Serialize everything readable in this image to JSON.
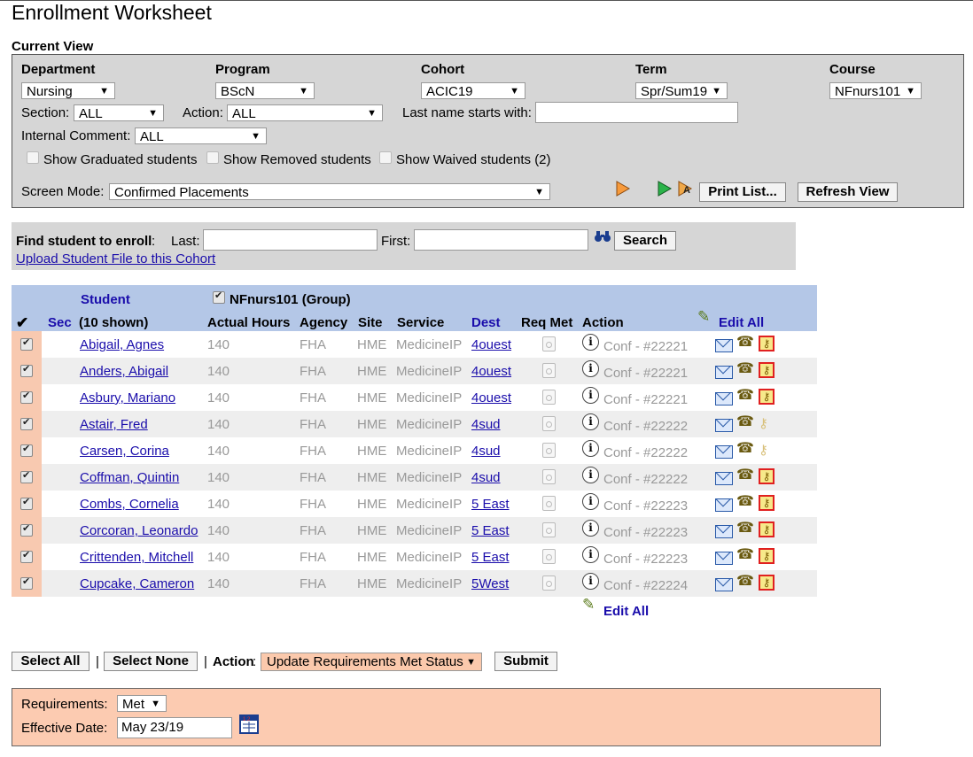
{
  "page_title": "Enrollment Worksheet",
  "current_view": {
    "title": "Current View",
    "department": {
      "label": "Department",
      "value": "Nursing"
    },
    "program": {
      "label": "Program",
      "value": "BScN"
    },
    "cohort": {
      "label": "Cohort",
      "value": "ACIC19"
    },
    "term": {
      "label": "Term",
      "value": "Spr/Sum19"
    },
    "course": {
      "label": "Course",
      "value": "NFnurs101"
    },
    "section": {
      "label": "Section:",
      "value": "ALL"
    },
    "action": {
      "label": "Action:",
      "value": "ALL"
    },
    "last_name": {
      "label": "Last name starts with:",
      "value": ""
    },
    "internal_comment": {
      "label": "Internal Comment:",
      "value": "ALL"
    },
    "show_graduated": {
      "label": "Show Graduated students",
      "checked": false
    },
    "show_removed": {
      "label": "Show Removed students",
      "checked": false
    },
    "show_waived": {
      "label": "Show Waived students (2)",
      "checked": false
    },
    "screen_mode": {
      "label": "Screen Mode:",
      "value": "Confirmed Placements"
    },
    "print_list": "Print List...",
    "refresh_view": "Refresh View"
  },
  "find": {
    "label": "Find student to enroll",
    "last_label": "Last:",
    "first_label": "First:",
    "search": "Search",
    "upload_link": "Upload Student File to this Cohort"
  },
  "grid": {
    "header_check": "✔",
    "student_link": "Student",
    "group_label": "NFnurs101  (Group)",
    "sec": "Sec",
    "shown": "(10 shown)",
    "actual_hours": "Actual Hours",
    "agency": "Agency",
    "site": "Site",
    "service": "Service",
    "dest": "Dest",
    "req_met": "Req Met",
    "action": "Action",
    "edit_all": "Edit All",
    "rows": [
      {
        "name": "Abigail, Agnes",
        "hours": "140",
        "agency": "FHA",
        "site": "HME",
        "service": "MedicineIP",
        "dest": "4ouest",
        "conf": "Conf - #22221",
        "key": "box"
      },
      {
        "name": "Anders, Abigail",
        "hours": "140",
        "agency": "FHA",
        "site": "HME",
        "service": "MedicineIP",
        "dest": "4ouest",
        "conf": "Conf - #22221",
        "key": "box"
      },
      {
        "name": "Asbury, Mariano",
        "hours": "140",
        "agency": "FHA",
        "site": "HME",
        "service": "MedicineIP",
        "dest": "4ouest",
        "conf": "Conf - #22221",
        "key": "box"
      },
      {
        "name": "Astair, Fred",
        "hours": "140",
        "agency": "FHA",
        "site": "HME",
        "service": "MedicineIP",
        "dest": "4sud",
        "conf": "Conf - #22222",
        "key": "plain"
      },
      {
        "name": "Carsen, Corina",
        "hours": "140",
        "agency": "FHA",
        "site": "HME",
        "service": "MedicineIP",
        "dest": "4sud",
        "conf": "Conf - #22222",
        "key": "plain"
      },
      {
        "name": "Coffman, Quintin",
        "hours": "140",
        "agency": "FHA",
        "site": "HME",
        "service": "MedicineIP",
        "dest": "4sud",
        "conf": "Conf - #22222",
        "key": "box"
      },
      {
        "name": "Combs, Cornelia",
        "hours": "140",
        "agency": "FHA",
        "site": "HME",
        "service": "MedicineIP",
        "dest": "5 East",
        "conf": "Conf - #22223",
        "key": "box"
      },
      {
        "name": "Corcoran, Leonardo",
        "hours": "140",
        "agency": "FHA",
        "site": "HME",
        "service": "MedicineIP",
        "dest": "5 East",
        "conf": "Conf - #22223",
        "key": "box"
      },
      {
        "name": "Crittenden, Mitchell",
        "hours": "140",
        "agency": "FHA",
        "site": "HME",
        "service": "MedicineIP",
        "dest": "5 East",
        "conf": "Conf - #22223",
        "key": "box"
      },
      {
        "name": "Cupcake, Cameron",
        "hours": "140",
        "agency": "FHA",
        "site": "HME",
        "service": "MedicineIP",
        "dest": "5West",
        "conf": "Conf - #22224",
        "key": "box"
      }
    ]
  },
  "bulk": {
    "select_all": "Select All",
    "select_none": "Select None",
    "sep": "|",
    "action_label": "Action",
    "action_value": "Update Requirements Met Status",
    "submit": "Submit"
  },
  "requirements": {
    "req_label": "Requirements:",
    "req_value": "Met",
    "date_label": "Effective Date:",
    "date_value": "May 23/19"
  }
}
